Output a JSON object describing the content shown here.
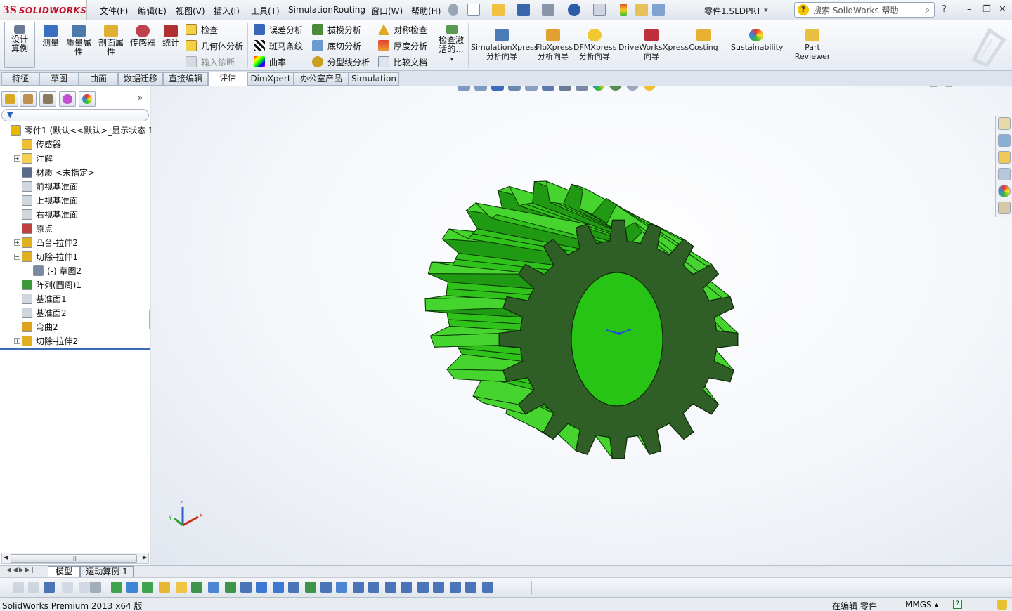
{
  "app": {
    "logo_mark": "3S",
    "logo_text": "SOLIDWORKS",
    "doc_title": "零件1.SLDPRT *",
    "help_search_placeholder": "搜索 SolidWorks 帮助"
  },
  "menu": [
    "文件(F)",
    "编辑(E)",
    "视图(V)",
    "插入(I)",
    "工具(T)",
    "Simulation",
    "Routing",
    "窗口(W)",
    "帮助(H)"
  ],
  "command_manager": {
    "big_buttons": [
      "设计算例",
      "测量",
      "质量属性",
      "剖面属性",
      "传感器",
      "统计"
    ],
    "col1": [
      "检查",
      "几何体分析",
      "输入诊断"
    ],
    "col2": [
      "误差分析",
      "斑马条纹",
      "曲率"
    ],
    "col3": [
      "拔模分析",
      "底切分析",
      "分型线分析"
    ],
    "col4": [
      "对称检查",
      "厚度分析",
      "比较文档"
    ],
    "check_active": "检查激活的...",
    "tools": [
      "SimulationXpress 分析向导",
      "FloXpress 分析向导",
      "DFMXpress 分析向导",
      "DriveWorksXpress 向导",
      "Costing",
      "Sustainability",
      "Part Reviewer"
    ]
  },
  "tabs": [
    "特征",
    "草图",
    "曲面",
    "数据迁移",
    "直接编辑",
    "评估",
    "DimXpert",
    "办公室产品",
    "Simulation"
  ],
  "active_tab": "评估",
  "feature_tree": [
    {
      "label": "零件1  (默认<<默认>_显示状态 1>",
      "depth": 0,
      "expand": "none",
      "icon": "part-icon",
      "color": "#e8b800"
    },
    {
      "label": "传感器",
      "depth": 1,
      "expand": "none",
      "icon": "sensor-icon",
      "color": "#f0c030"
    },
    {
      "label": "注解",
      "depth": 1,
      "expand": "plus",
      "icon": "annotation-icon",
      "color": "#f5d050"
    },
    {
      "label": "材质 <未指定>",
      "depth": 1,
      "expand": "none",
      "icon": "material-icon",
      "color": "#5a6a8a"
    },
    {
      "label": "前视基准面",
      "depth": 1,
      "expand": "none",
      "icon": "plane-icon",
      "color": "#d0d6de"
    },
    {
      "label": "上视基准面",
      "depth": 1,
      "expand": "none",
      "icon": "plane-icon",
      "color": "#d0d6de"
    },
    {
      "label": "右视基准面",
      "depth": 1,
      "expand": "none",
      "icon": "plane-icon",
      "color": "#d0d6de"
    },
    {
      "label": "原点",
      "depth": 1,
      "expand": "none",
      "icon": "origin-icon",
      "color": "#c04040"
    },
    {
      "label": "凸台-拉伸2",
      "depth": 1,
      "expand": "plus",
      "icon": "boss-extrude-icon",
      "color": "#e0b020"
    },
    {
      "label": "切除-拉伸1",
      "depth": 1,
      "expand": "minus",
      "icon": "cut-extrude-icon",
      "color": "#e0b020"
    },
    {
      "label": "(-) 草图2",
      "depth": 2,
      "expand": "none",
      "icon": "sketch-icon",
      "color": "#7a8aa0"
    },
    {
      "label": "阵列(圆周)1",
      "depth": 1,
      "expand": "none",
      "icon": "circular-pattern-icon",
      "color": "#3a9a3a"
    },
    {
      "label": "基准面1",
      "depth": 1,
      "expand": "none",
      "icon": "plane-icon",
      "color": "#d0d6de"
    },
    {
      "label": "基准面2",
      "depth": 1,
      "expand": "none",
      "icon": "plane-icon",
      "color": "#d0d6de"
    },
    {
      "label": "弯曲2",
      "depth": 1,
      "expand": "none",
      "icon": "flex-icon",
      "color": "#e0a020"
    },
    {
      "label": "切除-拉伸2",
      "depth": 1,
      "expand": "plus",
      "icon": "cut-extrude-icon",
      "color": "#e0b020"
    }
  ],
  "sheet_tabs": [
    "模型",
    "运动算例 1"
  ],
  "status": {
    "product": "SolidWorks Premium 2013 x64 版",
    "mode": "在编辑 零件",
    "units": "MMGS ▴"
  },
  "colors": {
    "gear_light": "#2fc21a",
    "gear_face": "#2f5e26",
    "gear_bore": "#27c415",
    "accent_blue": "#3c6bb4"
  }
}
